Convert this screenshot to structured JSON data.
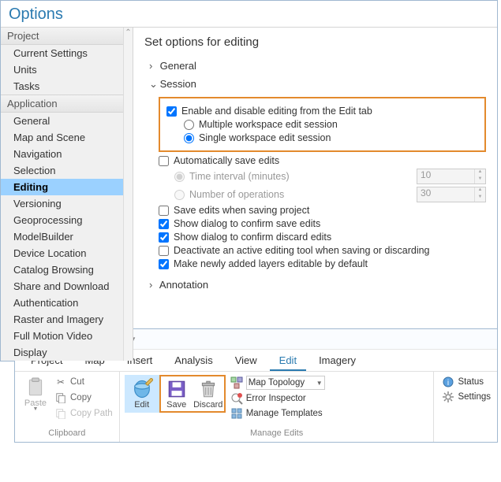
{
  "options": {
    "title": "Options",
    "pane_title": "Set options for editing",
    "groups": [
      {
        "label": "Project",
        "id": "project",
        "items": [
          {
            "label": "Current Settings",
            "id": "current-settings"
          },
          {
            "label": "Units",
            "id": "units"
          },
          {
            "label": "Tasks",
            "id": "tasks"
          }
        ]
      },
      {
        "label": "Application",
        "id": "application",
        "items": [
          {
            "label": "General",
            "id": "general"
          },
          {
            "label": "Map and Scene",
            "id": "map-scene"
          },
          {
            "label": "Navigation",
            "id": "navigation"
          },
          {
            "label": "Selection",
            "id": "selection"
          },
          {
            "label": "Editing",
            "id": "editing",
            "selected": true
          },
          {
            "label": "Versioning",
            "id": "versioning"
          },
          {
            "label": "Geoprocessing",
            "id": "geoprocessing"
          },
          {
            "label": "ModelBuilder",
            "id": "modelbuilder"
          },
          {
            "label": "Device Location",
            "id": "device-location"
          },
          {
            "label": "Catalog Browsing",
            "id": "catalog-browsing"
          },
          {
            "label": "Share and Download",
            "id": "share-download"
          },
          {
            "label": "Authentication",
            "id": "authentication"
          },
          {
            "label": "Raster and Imagery",
            "id": "raster-imagery"
          },
          {
            "label": "Full Motion Video",
            "id": "fmv"
          },
          {
            "label": "Display",
            "id": "display"
          }
        ]
      }
    ],
    "sections": {
      "general": "General",
      "session": "Session",
      "annotation": "Annotation"
    },
    "session": {
      "enable_label": "Enable and disable editing from the Edit tab",
      "multi_label": "Multiple workspace edit session",
      "single_label": "Single workspace edit session",
      "auto_save": "Automatically save edits",
      "time_interval_label": "Time interval (minutes)",
      "time_interval_value": "10",
      "num_ops_label": "Number of operations",
      "num_ops_value": "30",
      "save_project": "Save edits when saving project",
      "confirm_save": "Show dialog to confirm save edits",
      "confirm_discard": "Show dialog to confirm discard edits",
      "deactivate": "Deactivate an active editing tool when saving or discarding",
      "new_layers": "Make newly added layers editable by default"
    }
  },
  "ribbon": {
    "tabs": [
      "Project",
      "Map",
      "Insert",
      "Analysis",
      "View",
      "Edit",
      "Imagery"
    ],
    "active_tab": "Edit",
    "clipboard": {
      "group_label": "Clipboard",
      "paste": "Paste",
      "cut": "Cut",
      "copy": "Copy",
      "copy_path": "Copy Path"
    },
    "manage": {
      "group_label": "Manage Edits",
      "edit": "Edit",
      "save": "Save",
      "discard": "Discard",
      "topology": "Map Topology",
      "error_inspector": "Error Inspector",
      "manage_templates": "Manage Templates"
    },
    "features": {
      "status": "Status",
      "settings": "Settings"
    }
  }
}
